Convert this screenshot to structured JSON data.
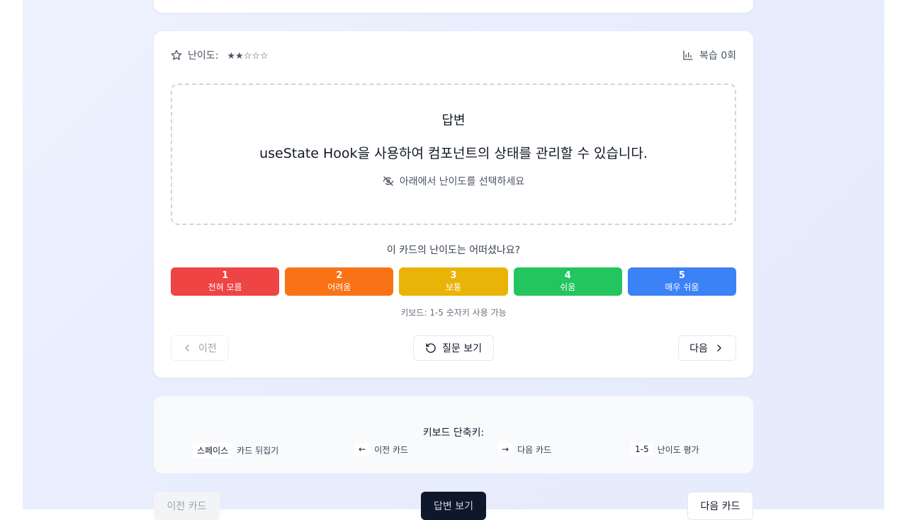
{
  "card": {
    "difficulty_label": "난이도:",
    "difficulty_stars": "★★☆☆☆",
    "review_count": "복습 0회",
    "answer_title": "답변",
    "answer_text": "useState Hook을 사용하여 컴포넌트의 상태를 관리할 수 있습니다.",
    "answer_hint": "아래에서 난이도를 선택하세요",
    "question": "이 카드의 난이도는 어떠셨나요?",
    "ratings": [
      {
        "num": "1",
        "label": "전혀 모름",
        "color": "#ef4444"
      },
      {
        "num": "2",
        "label": "어려움",
        "color": "#f97316"
      },
      {
        "num": "3",
        "label": "보통",
        "color": "#eab308"
      },
      {
        "num": "4",
        "label": "쉬움",
        "color": "#22c55e"
      },
      {
        "num": "5",
        "label": "매우 쉬움",
        "color": "#3b82f6"
      }
    ],
    "keyboard_hint": "키보드: 1-5 숫자키 사용 가능",
    "prev_label": "이전",
    "flip_label": "질문 보기",
    "next_label": "다음"
  },
  "shortcuts": {
    "title": "키보드 단축키:",
    "items": [
      {
        "key": "스페이스",
        "label": "카드 뒤집기"
      },
      {
        "key": "←",
        "label": "이전 카드"
      },
      {
        "key": "→",
        "label": "다음 카드"
      },
      {
        "key": "1-5",
        "label": "난이도 평가"
      }
    ]
  },
  "bottom_nav": {
    "prev_label": "이전 카드",
    "answer_label": "답변 보기",
    "next_label": "다음 카드"
  },
  "icons": {
    "star": "star-icon",
    "chart": "bar-chart-icon",
    "eye_off": "eye-off-icon",
    "chevron_left": "chevron-left-icon",
    "rotate": "rotate-ccw-icon",
    "chevron_right": "chevron-right-icon"
  }
}
